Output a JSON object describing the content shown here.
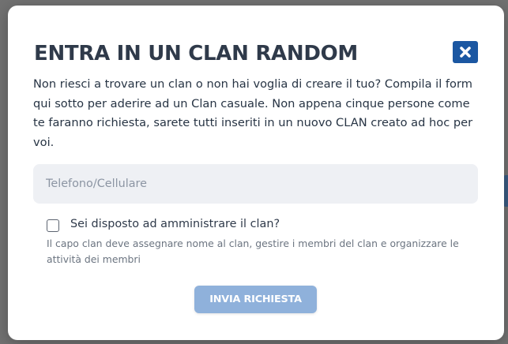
{
  "modal": {
    "title": "ENTRA IN UN CLAN RANDOM",
    "close_icon": "close-icon",
    "description": "Non riesci a trovare un clan o non hai voglia di creare il tuo? Compila il form qui sotto per aderire ad un Clan casuale. Non appena cinque persone come te faranno richiesta, sarete tutti inseriti in un nuovo CLAN creato ad hoc per voi.",
    "phone_placeholder": "Telefono/Cellulare",
    "phone_value": "",
    "admin_checkbox": {
      "checked": false,
      "label": "Sei disposto ad amministrare il clan?",
      "help": "Il capo clan deve assegnare nome al clan, gestire i membri del clan e organizzare le attività dei membri"
    },
    "submit_label": "INVIA RICHIESTA"
  },
  "colors": {
    "accent": "#1b57a2",
    "button_disabled": "#8fb1db",
    "overlay": "#717171",
    "input_bg": "#eef0f4"
  }
}
